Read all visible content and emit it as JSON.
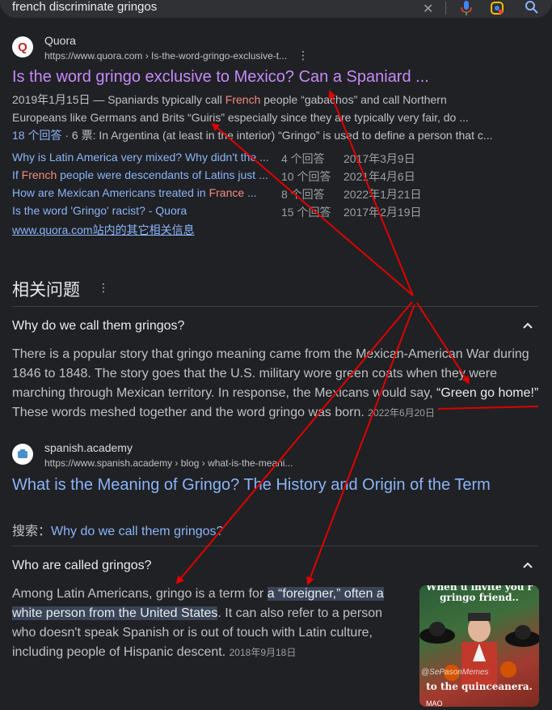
{
  "search": {
    "query": "french discriminate gringos",
    "icons": [
      "close-icon",
      "mic-icon",
      "lens-icon",
      "search-icon"
    ]
  },
  "result1": {
    "site": "Quora",
    "favicon_letter": "Q",
    "url": "https://www.quora.com › Is-the-word-gringo-exclusive-t...",
    "title": "Is the word gringo exclusive to Mexico? Can a Spaniard ...",
    "snippet": {
      "date": "2019年1月15日 — Spaniards typically call ",
      "hl": "French",
      "rest1": " people “gabachos” and call Northern",
      "line2": "Europeans like Germans and Brits “Guiris” especially since they are typically very fair, do ...",
      "answers_link": "18 个回答",
      "line3_rest": " · 6 票: In Argentina (at least in the interior) “Gringo” is used to define a person that c..."
    },
    "related": [
      {
        "q_pre": "Why is Latin America very mixed? Why didn't the ...",
        "q_hl": "",
        "q_post": "",
        "answers": "4 个回答",
        "date": "2017年3月9日"
      },
      {
        "q_pre": "If ",
        "q_hl": "French",
        "q_post": " people were descendants of Latins just ...",
        "answers": "10 个回答",
        "date": "2021年4月6日"
      },
      {
        "q_pre": "How are Mexican Americans treated in ",
        "q_hl": "France",
        "q_post": " ...",
        "answers": "8 个回答",
        "date": "2022年1月21日"
      },
      {
        "q_pre": "Is the word 'Gringo' racist? - Quora",
        "q_hl": "",
        "q_post": "",
        "answers": "15 个回答",
        "date": "2017年2月19日"
      }
    ],
    "more_link": "www.quora.com站内的其它相关信息"
  },
  "paa": {
    "heading": "相关问题",
    "q1": {
      "title": "Why do we call them gringos?",
      "l1": "There is a popular story that gringo meaning came from the Mexican-American War during",
      "l2": "1846 to 1848. The story goes that the U.S. military wore green coats when they were",
      "l3_pre": "marching through Mexican territory. In response, the Mexicans would say, ",
      "l3_quote": "“Green go home!”",
      "l4": "These words meshed together and the word gringo was born.",
      "date": "2022年6月20日",
      "source_site": "spanish.academy",
      "source_url": "https://www.spanish.academy › blog › what-is-the-meani...",
      "source_title": "What is the Meaning of Gringo? The History and Origin of the Term",
      "search_prefix": "搜索：",
      "search_link": "Why do we call them gringos?"
    },
    "q2": {
      "title": "Who are called gringos?",
      "l1_pre": "Among Latin Americans, gringo is a term for ",
      "l1_sel": "a “foreigner,” often a",
      "l2_sel": "white person from the United States",
      "l2_post": ". It can also refer to a person",
      "l3": "who doesn't speak Spanish or is out of touch with Latin culture,",
      "l4": "including people of Hispanic descent.",
      "date": "2018年9月18日",
      "image_top": "When u invite you r",
      "image_top2": "gringo friend..",
      "image_watermark": "@SePasonMemes",
      "image_bottom": "to the quinceanera.",
      "image_source": "MAO"
    }
  },
  "colors": {
    "background": "#202124",
    "link": "#8ab4f8",
    "visited": "#c58af9",
    "highlight": "#f28b82",
    "annotation": "#e00000"
  }
}
